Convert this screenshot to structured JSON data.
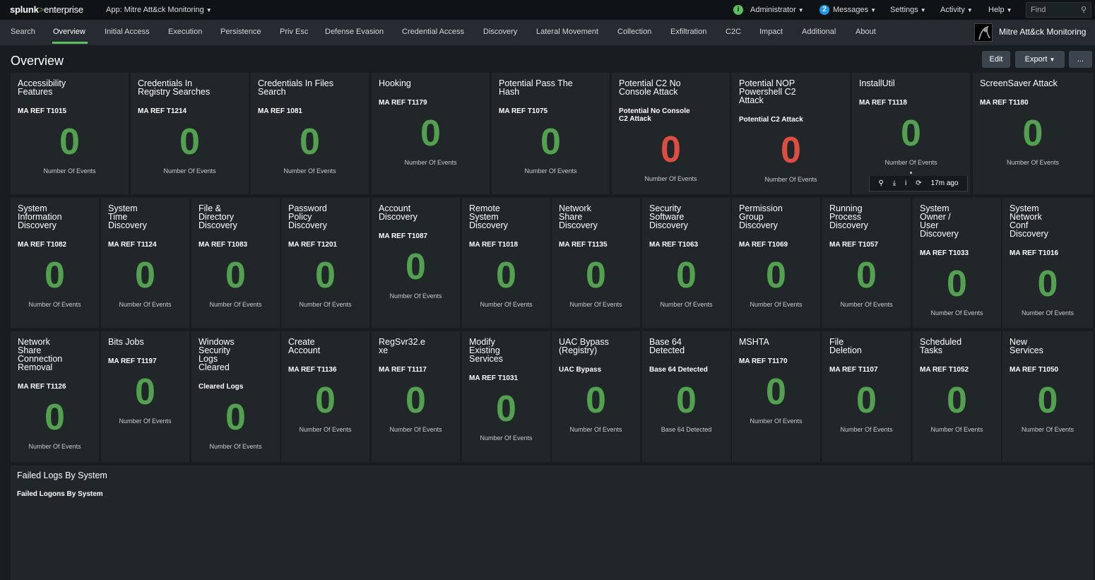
{
  "topbar": {
    "logo_part1": "splunk",
    "logo_part2": ">",
    "logo_part3": "enterprise",
    "app_label": "App: Mitre Att&ck Monitoring",
    "admin_badge": "i",
    "administrator": "Administrator",
    "messages_count": "2",
    "messages": "Messages",
    "settings": "Settings",
    "activity": "Activity",
    "help": "Help",
    "find_placeholder": "Find"
  },
  "nav": {
    "items": [
      "Search",
      "Overview",
      "Initial Access",
      "Execution",
      "Persistence",
      "Priv Esc",
      "Defense Evasion",
      "Credential Access",
      "Discovery",
      "Lateral Movement",
      "Collection",
      "Exfiltration",
      "C2C",
      "Impact",
      "Additional",
      "About"
    ],
    "active": "Overview",
    "app_title": "Mitre Att&ck Monitoring"
  },
  "dashboard": {
    "title": "Overview",
    "edit": "Edit",
    "export": "Export",
    "more": "..."
  },
  "row1": [
    {
      "title": "Accessibility\nFeatures",
      "sub": "MA REF T1015",
      "value": "0",
      "unit": "Number Of Events",
      "alert": false
    },
    {
      "title": "Credentials In\nRegistry Searches",
      "sub": "MA REF T1214",
      "value": "0",
      "unit": "Number Of Events",
      "alert": false
    },
    {
      "title": "Credentials In Files\nSearch",
      "sub": "MA REF 1081",
      "value": "0",
      "unit": "Number Of Events",
      "alert": false
    },
    {
      "title": "Hooking",
      "sub": "MA REF T1179",
      "value": "0",
      "unit": "Number Of Events",
      "alert": false
    },
    {
      "title": "Potential Pass The\nHash",
      "sub": "MA REF T1075",
      "value": "0",
      "unit": "Number Of Events",
      "alert": false
    },
    {
      "title": "Potential C2 No\nConsole Attack",
      "sub": "Potential No Console\nC2 Attack",
      "value": "0",
      "unit": "Number Of Events",
      "alert": true
    },
    {
      "title": "Potential NOP\nPowershell C2\nAttack",
      "sub": "Potential C2 Attack",
      "value": "0",
      "unit": "Number Of Events",
      "alert": true
    },
    {
      "title": "InstallUtil",
      "sub": "MA REF T1118",
      "value": "0",
      "unit": "Number Of Events",
      "alert": false
    },
    {
      "title": "ScreenSaver Attack",
      "sub": "MA REF T1180",
      "value": "0",
      "unit": "Number Of Events",
      "alert": false
    }
  ],
  "hover_toolbar": {
    "search": "⚲",
    "download": "⤓",
    "info": "i",
    "refresh": "⟳",
    "time": "17m ago"
  },
  "row2": [
    {
      "title": "System\nInformation\nDiscovery",
      "sub": "MA REF T1082",
      "value": "0",
      "unit": "Number Of Events"
    },
    {
      "title": "System\nTime\nDiscovery",
      "sub": "MA REF T1124",
      "value": "0",
      "unit": "Number Of Events"
    },
    {
      "title": "File &\nDirectory\nDiscovery",
      "sub": "MA REF T1083",
      "value": "0",
      "unit": "Number Of Events"
    },
    {
      "title": "Password\nPolicy\nDiscovery",
      "sub": "MA REF T1201",
      "value": "0",
      "unit": "Number Of Events"
    },
    {
      "title": "Account\nDiscovery",
      "sub": "MA REF T1087",
      "value": "0",
      "unit": "Number Of Events"
    },
    {
      "title": "Remote\nSystem\nDiscovery",
      "sub": "MA REF T1018",
      "value": "0",
      "unit": "Number Of Events"
    },
    {
      "title": "Network\nShare\nDiscovery",
      "sub": "MA REF T1135",
      "value": "0",
      "unit": "Number Of Events"
    },
    {
      "title": "Security\nSoftware\nDiscovery",
      "sub": "MA REF T1063",
      "value": "0",
      "unit": "Number Of Events"
    },
    {
      "title": "Permission\nGroup\nDiscovery",
      "sub": "MA REF T1069",
      "value": "0",
      "unit": "Number Of Events"
    },
    {
      "title": "Running\nProcess\nDiscovery",
      "sub": "MA REF T1057",
      "value": "0",
      "unit": "Number Of Events"
    },
    {
      "title": "System\nOwner /\nUser\nDiscovery",
      "sub": "MA REF T1033",
      "value": "0",
      "unit": "Number Of Events"
    },
    {
      "title": "System\nNetwork\nConf\nDiscovery",
      "sub": "MA REF T1016",
      "value": "0",
      "unit": "Number Of Events"
    }
  ],
  "row3": [
    {
      "title": "Network\nShare\nConnection\nRemoval",
      "sub": "MA REF T1126",
      "value": "0",
      "unit": "Number Of Events"
    },
    {
      "title": "Bits Jobs",
      "sub": "MA REF T1197",
      "value": "0",
      "unit": "Number Of Events"
    },
    {
      "title": "Windows\nSecurity\nLogs\nCleared",
      "sub": "Cleared Logs",
      "value": "0",
      "unit": "Number Of Events"
    },
    {
      "title": "Create\nAccount",
      "sub": "MA REF T1136",
      "value": "0",
      "unit": "Number Of Events"
    },
    {
      "title": "RegSvr32.e\nxe",
      "sub": "MA REF T1117",
      "value": "0",
      "unit": "Number Of Events"
    },
    {
      "title": "Modify\nExisting\nServices",
      "sub": "MA REF T1031",
      "value": "0",
      "unit": "Number Of Events"
    },
    {
      "title": "UAC Bypass\n(Registry)",
      "sub": "UAC Bypass",
      "value": "0",
      "unit": "Number Of Events"
    },
    {
      "title": "Base 64\nDetected",
      "sub": "Base 64 Detected",
      "value": "0",
      "unit": "Base 64 Detected"
    },
    {
      "title": "MSHTA",
      "sub": "MA REF T1170",
      "value": "0",
      "unit": "Number Of Events"
    },
    {
      "title": "File\nDeletion",
      "sub": "MA REF T1107",
      "value": "0",
      "unit": "Number Of Events"
    },
    {
      "title": "Scheduled\nTasks",
      "sub": "MA REF T1052",
      "value": "0",
      "unit": "Number Of Events"
    },
    {
      "title": "New\nServices",
      "sub": "MA REF T1050",
      "value": "0",
      "unit": "Number Of Events"
    }
  ],
  "failed_panel": {
    "title": "Failed Logs By System",
    "sub": "Failed Logons By System"
  },
  "colors": {
    "ok": "#53a051",
    "alert": "#dc4e41",
    "accent": "#5cc05c",
    "messages_badge": "#1a9ae8"
  }
}
